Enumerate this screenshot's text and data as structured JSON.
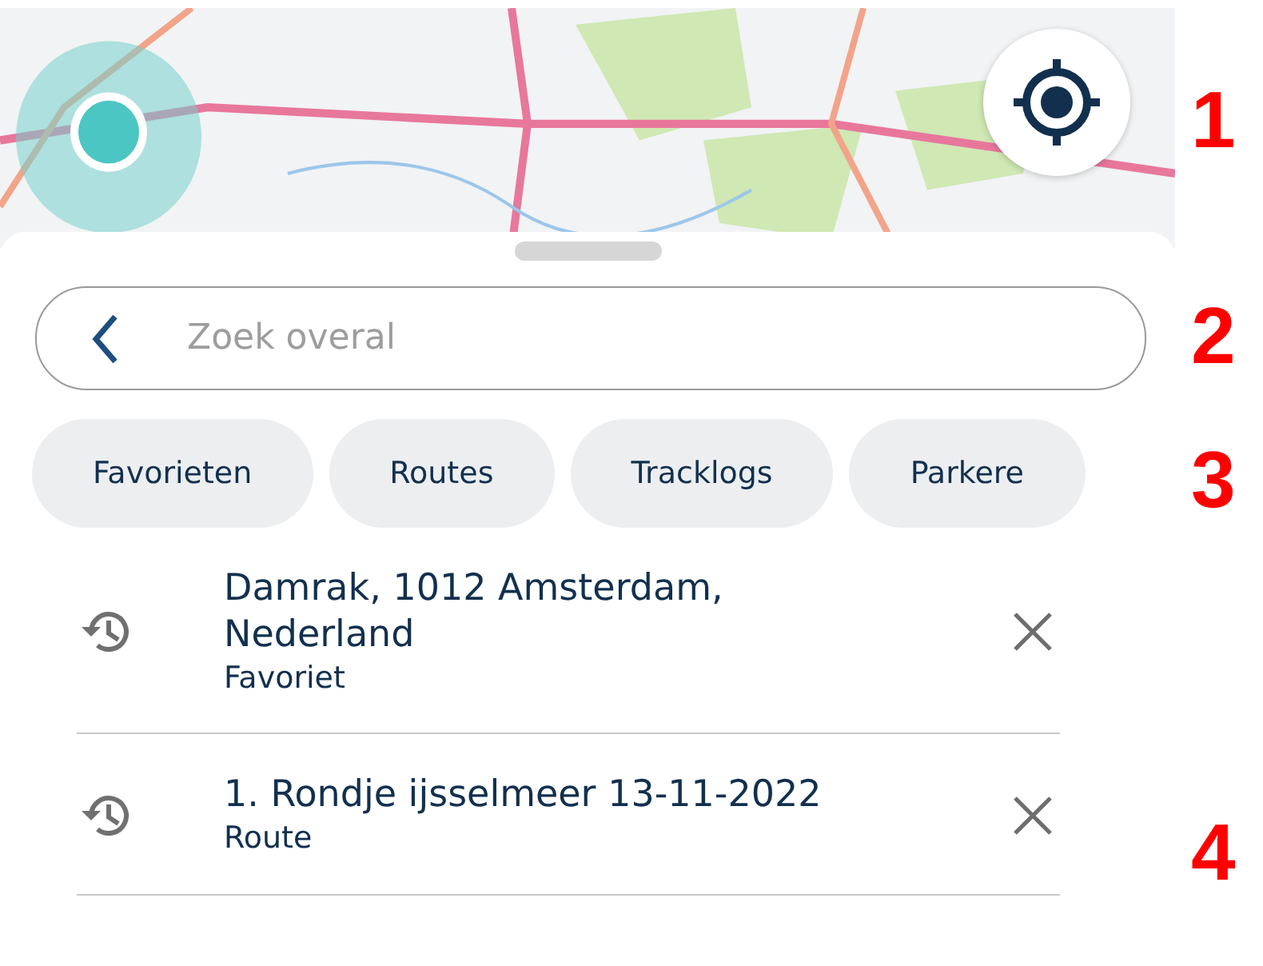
{
  "search": {
    "placeholder": "Zoek overal"
  },
  "chips": [
    "Favorieten",
    "Routes",
    "Tracklogs",
    "Parkere"
  ],
  "recent": [
    {
      "title": "Damrak, 1012 Amsterdam, Nederland",
      "subtitle": "Favoriet"
    },
    {
      "title": "1. Rondje ijsselmeer 13-11-2022",
      "subtitle": "Route"
    }
  ],
  "annotations": [
    "1",
    "2",
    "3",
    "4"
  ]
}
